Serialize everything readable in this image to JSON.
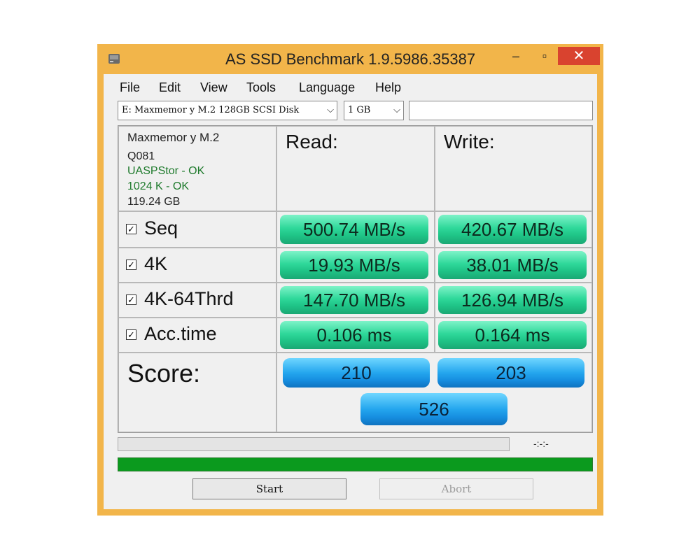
{
  "window": {
    "title": "AS SSD Benchmark 1.9.5986.35387",
    "minimize": "–",
    "maximize": "▫",
    "close": "✕"
  },
  "menu": [
    "File",
    "Edit",
    "View",
    "Tools",
    "Language",
    "Help"
  ],
  "drive_select": {
    "value": "E: Maxmemor y M.2 128GB SCSI Disk"
  },
  "size_select": {
    "value": "1 GB"
  },
  "text_field": {
    "value": ""
  },
  "drive_info": {
    "name": "Maxmemor y M.2",
    "firmware": "Q081",
    "driver": "UASPStor - OK",
    "alignment": "1024 K - OK",
    "size": "119.24 GB"
  },
  "headers": {
    "read": "Read:",
    "write": "Write:"
  },
  "rows": [
    {
      "label": "Seq",
      "read": "500.74 MB/s",
      "write": "420.67 MB/s",
      "checked": true
    },
    {
      "label": "4K",
      "read": "19.93 MB/s",
      "write": "38.01 MB/s",
      "checked": true
    },
    {
      "label": "4K-64Thrd",
      "read": "147.70 MB/s",
      "write": "126.94 MB/s",
      "checked": true
    },
    {
      "label": "Acc.time",
      "read": "0.106 ms",
      "write": "0.164 ms",
      "checked": true
    }
  ],
  "score": {
    "label": "Score:",
    "read": "210",
    "write": "203",
    "total": "526"
  },
  "status": {
    "time": "-:-:-",
    "progress_fraction": 1.0
  },
  "buttons": {
    "start": "Start",
    "abort": "Abort"
  },
  "check_mark": "✓",
  "colors": {
    "value_green": "#2fd89a",
    "score_blue": "#24a6ee",
    "progress_green": "#0b9a1e",
    "window_frame": "#f2b54a",
    "close_red": "#d9432f"
  }
}
